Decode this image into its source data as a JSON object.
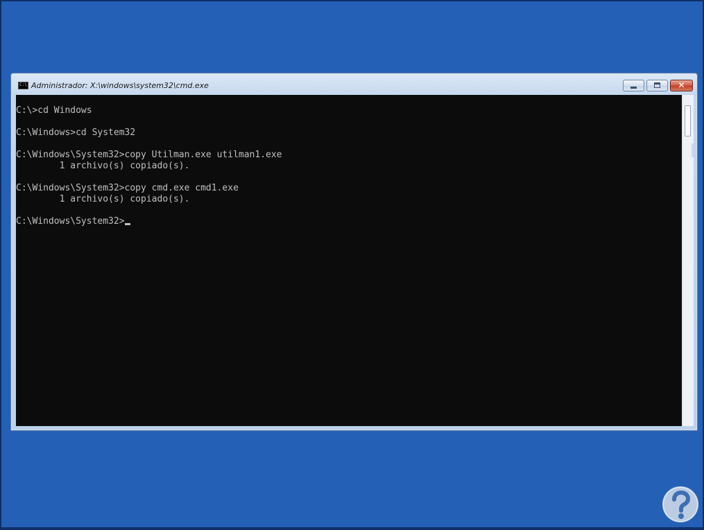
{
  "window": {
    "title": "Administrador: X:\\windows\\system32\\cmd.exe",
    "icon": "cmd-app-icon",
    "icon_glyph": "C:\\",
    "controls": {
      "minimize_icon": "minimize-icon",
      "maximize_icon": "maximize-icon",
      "close_icon": "close-icon",
      "close_glyph": "✕"
    }
  },
  "console": {
    "lines": [
      "C:\\>cd Windows",
      "",
      "C:\\Windows>cd System32",
      "",
      "C:\\Windows\\System32>copy Utilman.exe utilman1.exe",
      "        1 archivo(s) copiado(s).",
      "",
      "C:\\Windows\\System32>copy cmd.exe cmd1.exe",
      "        1 archivo(s) copiado(s).",
      "",
      "C:\\Windows\\System32>"
    ],
    "background": "#0c0c0c",
    "foreground": "#c0c0c0"
  },
  "colors": {
    "desktop": "#2461b6",
    "window_frame": "#c3d6ec",
    "close_button": "#c1432a"
  },
  "watermark": {
    "icon": "question-mark-logo-icon"
  }
}
